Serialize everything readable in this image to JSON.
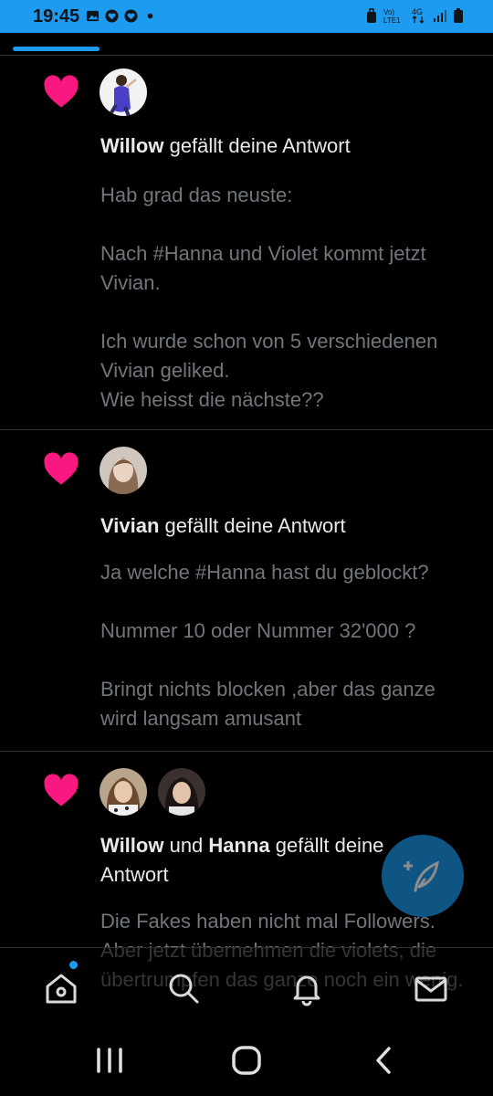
{
  "status_bar": {
    "time": "19:45"
  },
  "notifications": [
    {
      "users": [
        "Willow"
      ],
      "text_after": " gefällt deine Antwort",
      "body": "Hab grad das neuste:\n\nNach #Hanna und Violet kommt jetzt Vivian.\n\nIch wurde schon von 5 verschiedenen Vivian geliked.\nWie heisst die nächste??"
    },
    {
      "users": [
        "Vivian"
      ],
      "text_after": " gefällt deine Antwort",
      "body": "Ja welche #Hanna hast du geblockt?\n\nNummer 10 oder Nummer 32'000 ?\n\nBringt nichts blocken ,aber das ganze wird langsam amusant"
    },
    {
      "users": [
        "Willow",
        "Hanna"
      ],
      "joiner": " und ",
      "text_after": " gefällt deine Antwort",
      "body": "Die Fakes haben nicht mal Followers.\nAber jetzt übernehmen die violets, die übertrumpfen das ganze noch ein wenig."
    }
  ],
  "colors": {
    "accent": "#1d9bf0",
    "heart": "#f91880",
    "background": "#000000",
    "muted": "#71767b"
  },
  "icons": {
    "nav": [
      "home-icon",
      "search-icon",
      "bell-icon",
      "mail-icon"
    ],
    "fab": "compose-feather-icon"
  }
}
